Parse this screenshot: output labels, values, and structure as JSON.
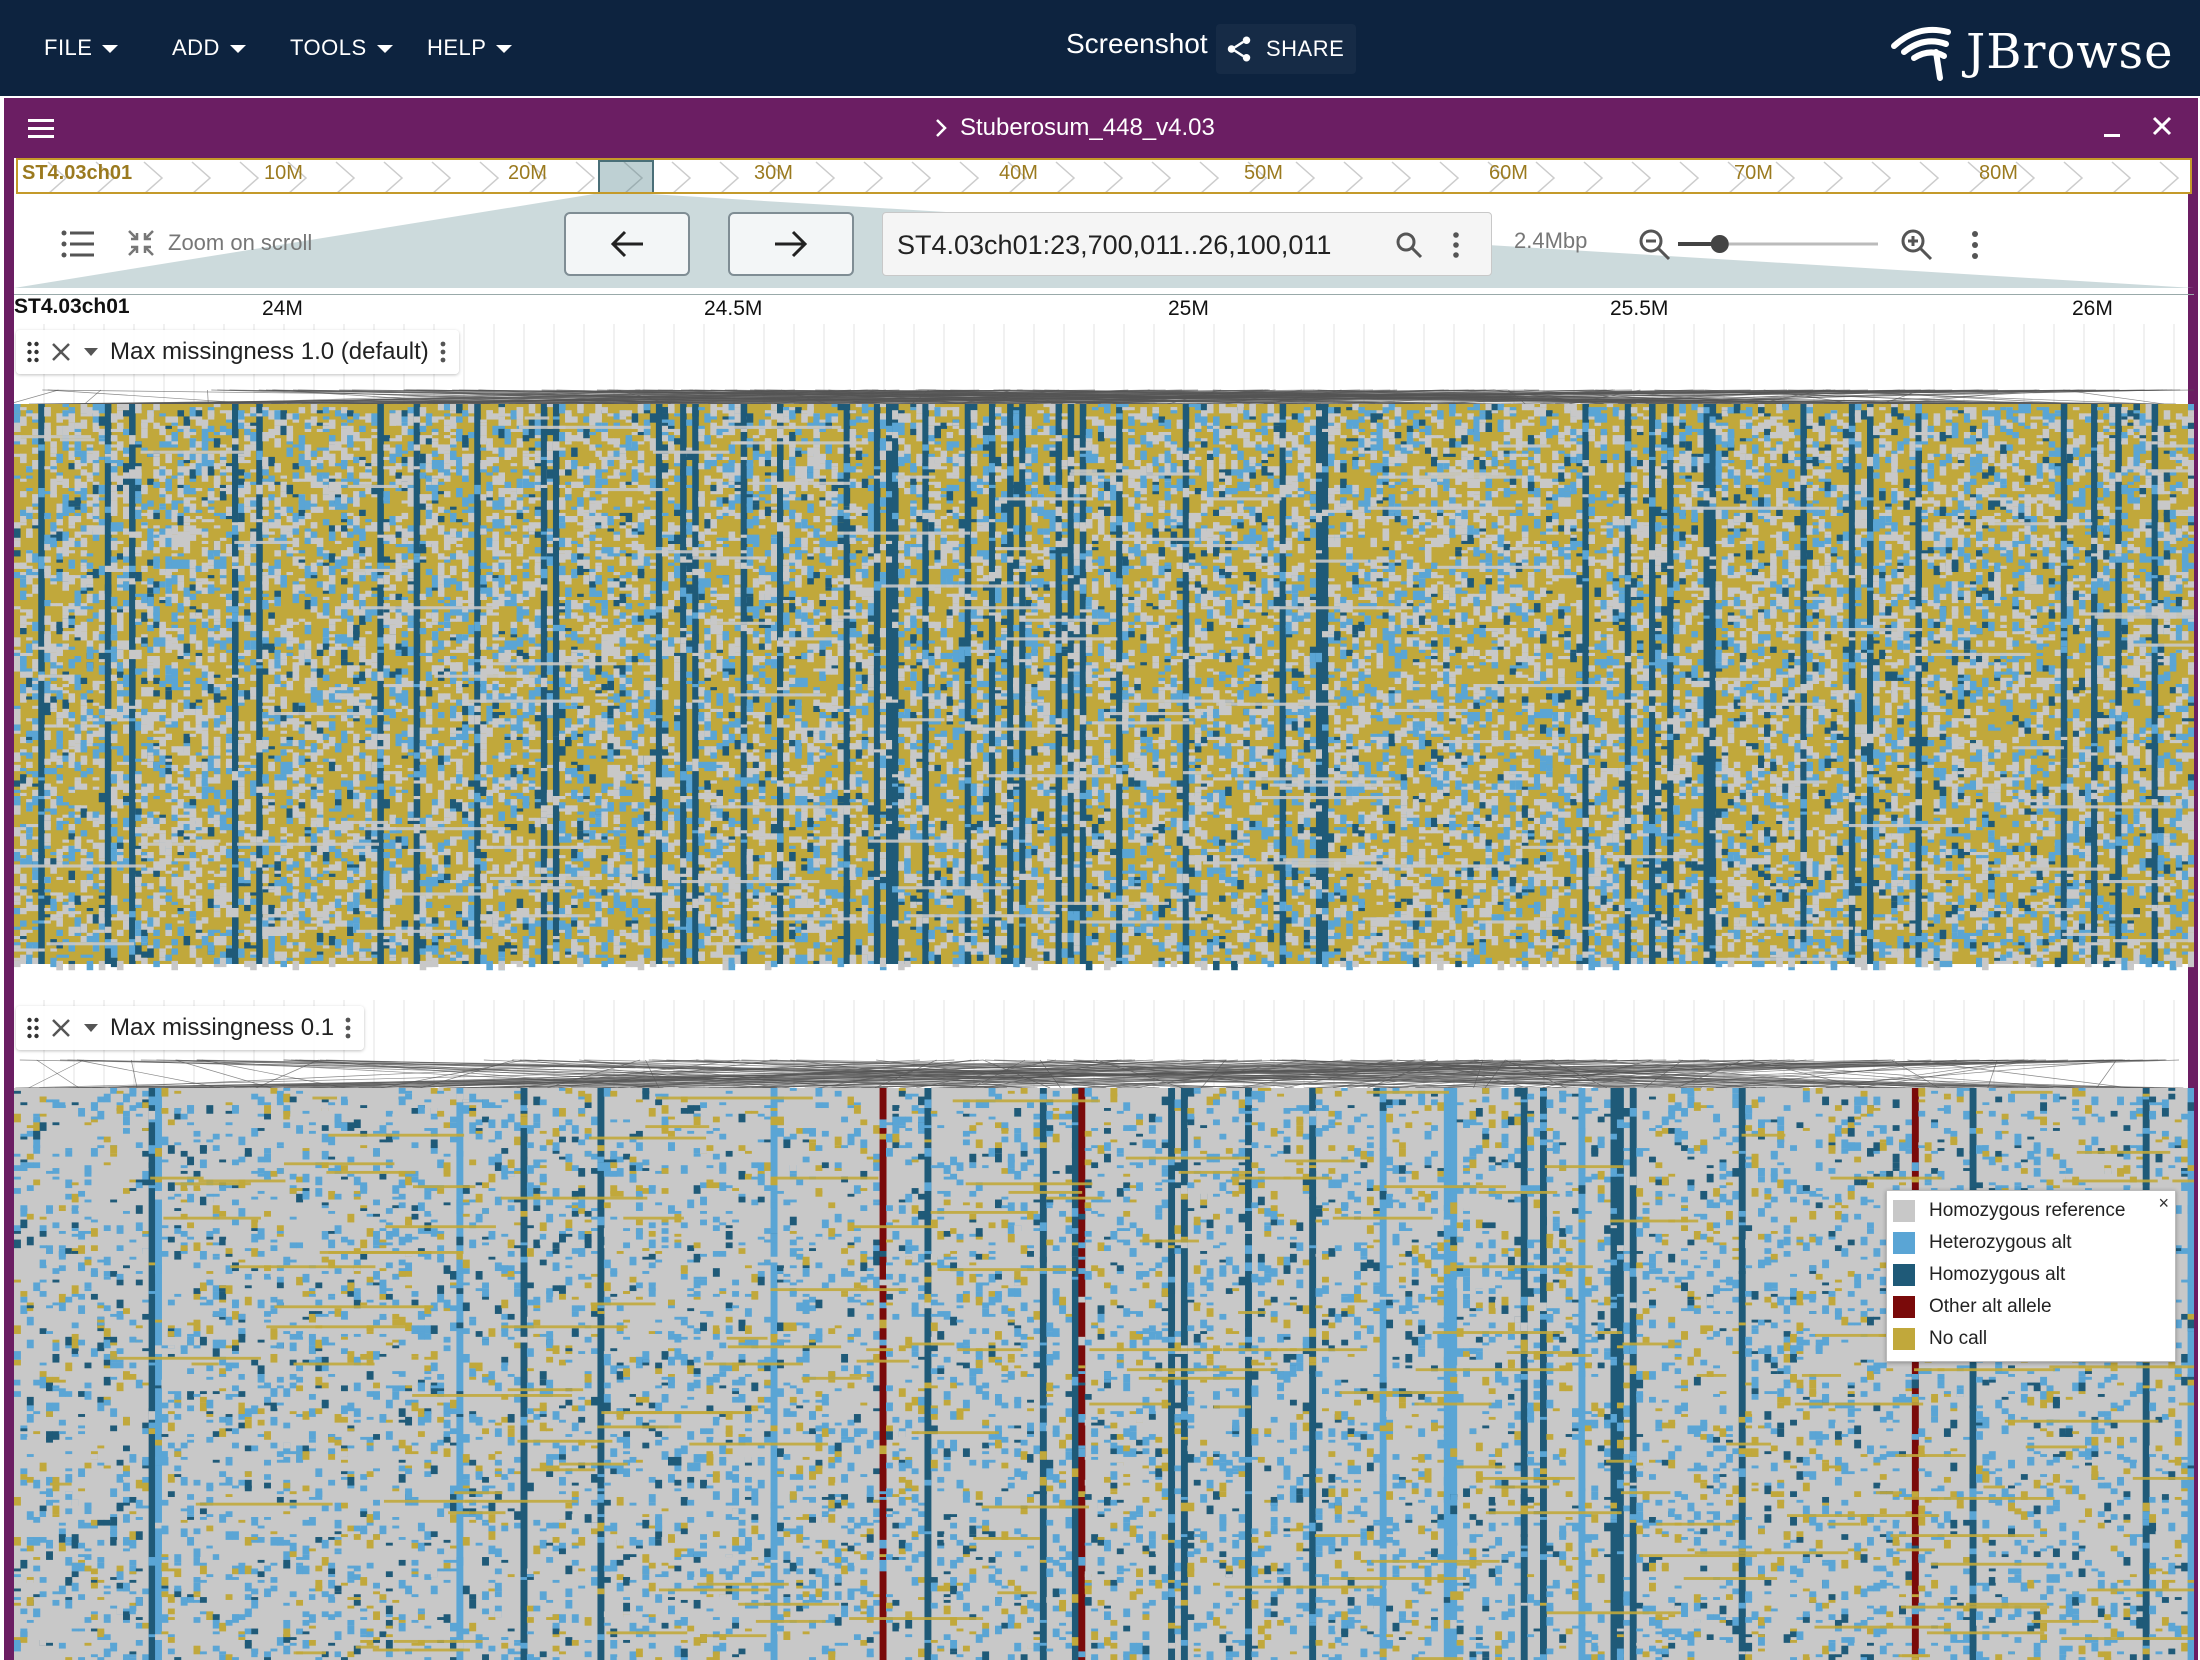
{
  "appbar": {
    "menus": [
      "FILE",
      "ADD",
      "TOOLS",
      "HELP"
    ],
    "session_title": "Screenshot",
    "share_label": "SHARE",
    "logo_text": "JBrowse"
  },
  "view": {
    "assembly_title": "Stuberosum_448_v4.03"
  },
  "overview": {
    "chrom_label": "ST4.03ch01",
    "tick_labels": [
      "10M",
      "20M",
      "30M",
      "40M",
      "50M",
      "60M",
      "70M",
      "80M"
    ]
  },
  "toolbar": {
    "zoom_on_scroll_label": "Zoom on scroll",
    "locstring": "ST4.03ch01:23,700,011..26,100,011",
    "bp_per_px": "2.4Mbp",
    "zoom_level": 0.18
  },
  "ruler": {
    "chrom_label": "ST4.03ch01",
    "tick_labels": [
      "24M",
      "24.5M",
      "25M",
      "25.5M",
      "26M"
    ]
  },
  "tracks": [
    {
      "name": "Max missingness 1.0 (default)",
      "missingness_threshold": 1.0
    },
    {
      "name": "Max missingness 0.1",
      "missingness_threshold": 0.1
    }
  ],
  "legend": {
    "items": [
      {
        "label": "Homozygous reference",
        "color": "#c8c8c8"
      },
      {
        "label": "Heterozygous alt",
        "color": "#5aa5d5"
      },
      {
        "label": "Homozygous alt",
        "color": "#1f5a78"
      },
      {
        "label": "Other alt allele",
        "color": "#7a0a0a"
      },
      {
        "label": "No call",
        "color": "#c1a83b"
      }
    ],
    "close_glyph": "×"
  },
  "colors": {
    "appbar": "#0d233f",
    "view_frame": "#6b1e63",
    "overview_border": "#c49a2a"
  },
  "icons": [
    "caret-down-icon",
    "share-icon",
    "jbrowse-logo-icon",
    "hamburger-icon",
    "chevron-right-icon",
    "minimize-icon",
    "close-icon",
    "track-list-icon",
    "zoom-scroll-icon",
    "arrow-left-icon",
    "arrow-right-icon",
    "search-icon",
    "more-vert-icon",
    "zoom-out-icon",
    "zoom-in-icon",
    "drag-handle-icon"
  ]
}
